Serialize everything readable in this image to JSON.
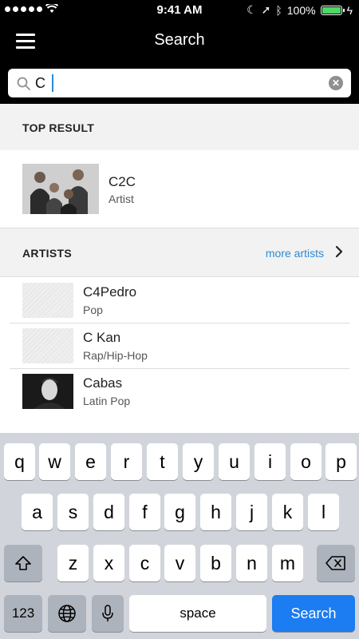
{
  "status_bar": {
    "time": "9:41 AM",
    "battery": "100%"
  },
  "nav": {
    "title": "Search"
  },
  "search": {
    "value": "C"
  },
  "top_result": {
    "header": "TOP RESULT",
    "title": "C2C",
    "subtitle": "Artist"
  },
  "artists": {
    "header": "ARTISTS",
    "more_label": "more artists",
    "items": [
      {
        "name": "C4Pedro",
        "genre": "Pop"
      },
      {
        "name": "C Kan",
        "genre": "Rap/Hip-Hop"
      },
      {
        "name": "Cabas",
        "genre": "Latin Pop"
      }
    ]
  },
  "keyboard": {
    "row1": [
      "q",
      "w",
      "e",
      "r",
      "t",
      "y",
      "u",
      "i",
      "o",
      "p"
    ],
    "row2": [
      "a",
      "s",
      "d",
      "f",
      "g",
      "h",
      "j",
      "k",
      "l"
    ],
    "row3": [
      "z",
      "x",
      "c",
      "v",
      "b",
      "n",
      "m"
    ],
    "numbers_label": "123",
    "space_label": "space",
    "search_label": "Search"
  },
  "colors": {
    "accent": "#2a8bd8",
    "search_key": "#1c7cf1",
    "header_bg": "#f2f2f2"
  }
}
